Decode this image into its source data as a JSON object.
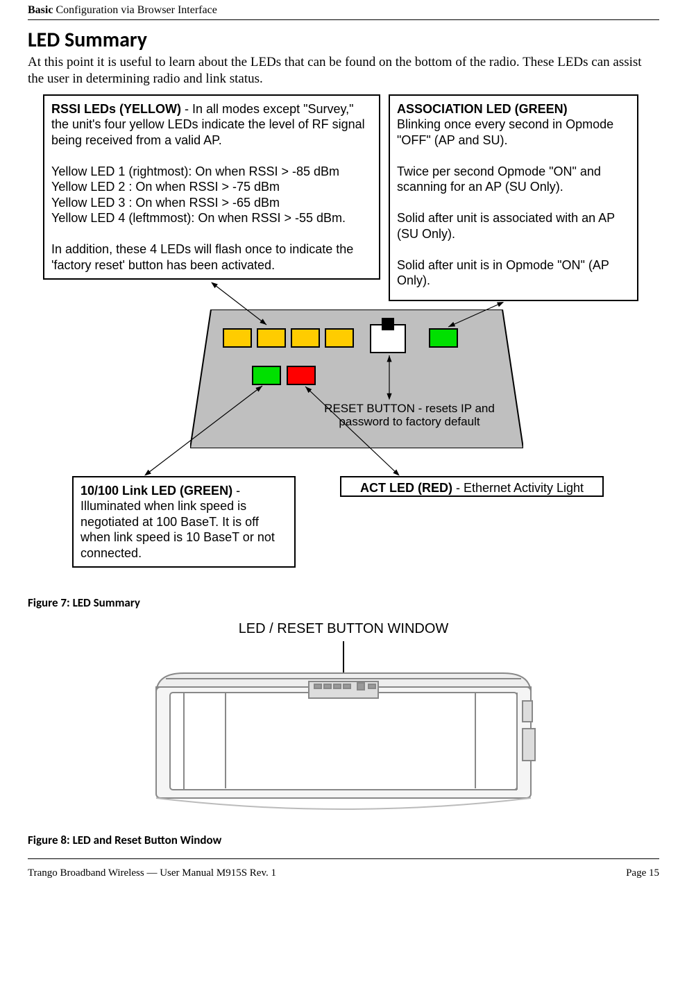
{
  "header": {
    "section_bold": "Basic",
    "section_rest": " Configuration via Browser Interface"
  },
  "title": "LED Summary",
  "lead": "At this point it is useful to learn about the LEDs that can be found on the bottom of the radio.  These LEDs can assist the user in determining radio and link status.",
  "callouts": {
    "rssi": {
      "title": "RSSI LEDs (YELLOW)",
      "intro": " - In all modes except \"Survey,\" the unit's four yellow LEDs indicate the level of RF signal being received from a valid AP.",
      "lines": [
        "Yellow LED 1 (rightmost): On when RSSI >  -85 dBm",
        "Yellow LED 2 : On when RSSI > -75 dBm",
        "Yellow LED 3 : On when RSSI > -65 dBm",
        "Yellow LED 4 (leftmmost): On when RSSI > -55 dBm."
      ],
      "tail": "In addition, these 4 LEDs will flash once to indicate the 'factory reset' button has been activated."
    },
    "assoc": {
      "title": "ASSOCIATION LED (GREEN)",
      "p1": "Blinking once every second in Opmode \"OFF\" (AP and SU).",
      "p2": "Twice per second Opmode \"ON\" and scanning for an AP (SU Only).",
      "p3": "Solid after unit is associated with an AP (SU Only).",
      "p4": "Solid after unit is in Opmode \"ON\" (AP Only)."
    },
    "link": {
      "title": "10/100 Link LED  (GREEN)",
      "body": " - Illuminated when link speed is negotiated at 100 BaseT.  It is off when link speed is 10 BaseT or not connected."
    },
    "act": {
      "title": "ACT LED (RED)",
      "body": " - Ethernet Activity Light"
    },
    "reset": "RESET BUTTON - resets IP and password to factory default"
  },
  "figure7": "Figure 7:  LED Summary",
  "window_title": "LED / RESET BUTTON WINDOW",
  "figure8": "Figure 8:  LED and Reset Button Window",
  "footer": {
    "left": "Trango Broadband Wireless — User Manual M915S Rev. 1",
    "right": "Page 15"
  }
}
